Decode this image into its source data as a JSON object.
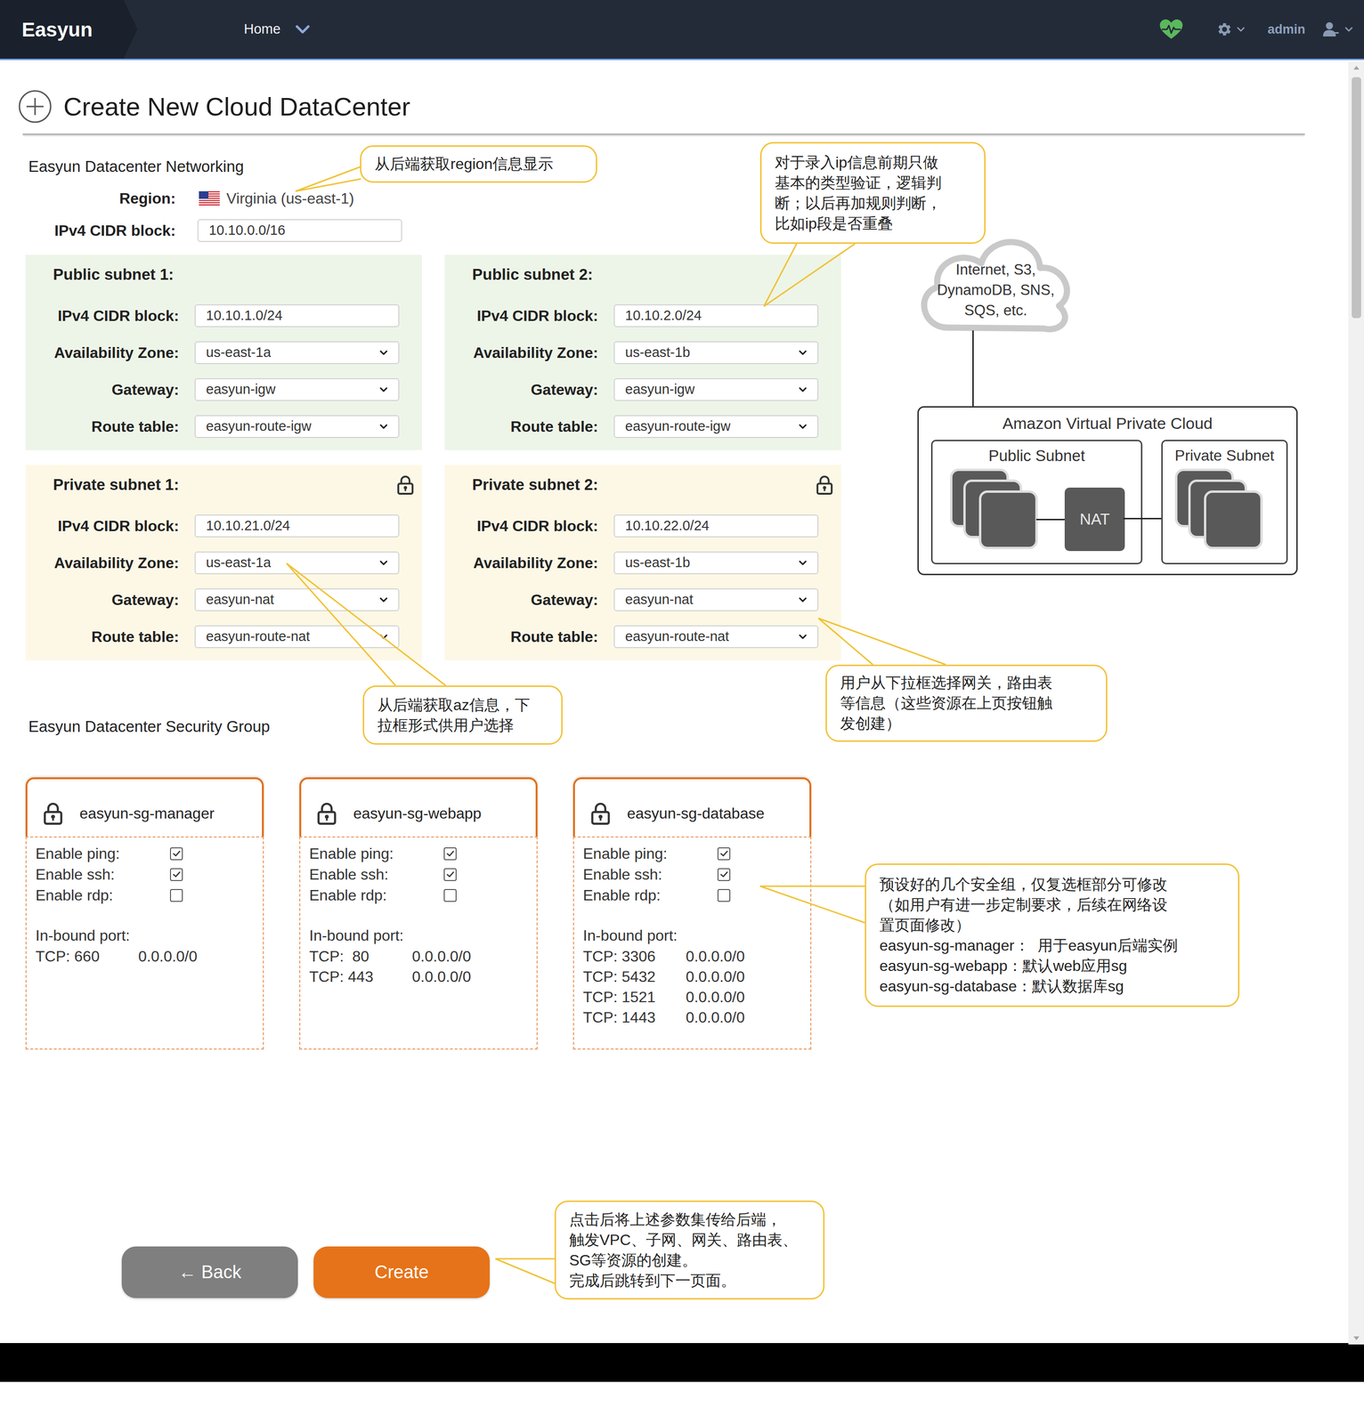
{
  "nav": {
    "logo": "Easyun",
    "menu": "Home",
    "user": "admin"
  },
  "page": {
    "title": "Create New Cloud DataCenter"
  },
  "networking": {
    "title": "Easyun Datacenter Networking",
    "region_label": "Region:",
    "region": "Virginia (us-east-1)",
    "cidr_label": "IPv4 CIDR block:",
    "cidr": "10.10.0.0/16",
    "subnets": [
      {
        "title": "Public subnet 1:",
        "kind": "public",
        "fields": [
          {
            "label": "IPv4 CIDR block:",
            "value": "10.10.1.0/24",
            "kind": "input"
          },
          {
            "label": "Availability Zone:",
            "value": "us-east-1a",
            "kind": "select"
          },
          {
            "label": "Gateway:",
            "value": "easyun-igw",
            "kind": "select"
          },
          {
            "label": "Route table:",
            "value": "easyun-route-igw",
            "kind": "select"
          }
        ]
      },
      {
        "title": "Public subnet 2:",
        "kind": "public",
        "fields": [
          {
            "label": "IPv4 CIDR block:",
            "value": "10.10.2.0/24",
            "kind": "input"
          },
          {
            "label": "Availability Zone:",
            "value": "us-east-1b",
            "kind": "select"
          },
          {
            "label": "Gateway:",
            "value": "easyun-igw",
            "kind": "select"
          },
          {
            "label": "Route table:",
            "value": "easyun-route-igw",
            "kind": "select"
          }
        ]
      },
      {
        "title": "Private subnet 1:",
        "kind": "private",
        "fields": [
          {
            "label": "IPv4 CIDR block:",
            "value": "10.10.21.0/24",
            "kind": "input"
          },
          {
            "label": "Availability Zone:",
            "value": "us-east-1a",
            "kind": "select"
          },
          {
            "label": "Gateway:",
            "value": "easyun-nat",
            "kind": "select"
          },
          {
            "label": "Route table:",
            "value": "easyun-route-nat",
            "kind": "select"
          }
        ]
      },
      {
        "title": "Private subnet 2:",
        "kind": "private",
        "fields": [
          {
            "label": "IPv4 CIDR block:",
            "value": "10.10.22.0/24",
            "kind": "input"
          },
          {
            "label": "Availability Zone:",
            "value": "us-east-1b",
            "kind": "select"
          },
          {
            "label": "Gateway:",
            "value": "easyun-nat",
            "kind": "select"
          },
          {
            "label": "Route table:",
            "value": "easyun-route-nat",
            "kind": "select"
          }
        ]
      }
    ]
  },
  "security": {
    "title": "Easyun Datacenter Security Group",
    "groups": [
      {
        "name": "easyun-sg-manager",
        "options": [
          {
            "label": "Enable ping:",
            "checked": true
          },
          {
            "label": "Enable ssh:",
            "checked": true
          },
          {
            "label": "Enable rdp:",
            "checked": false
          }
        ],
        "inbound_label": "In-bound port:",
        "ports": [
          {
            "port": "TCP: 660",
            "cidr": "0.0.0.0/0"
          }
        ]
      },
      {
        "name": "easyun-sg-webapp",
        "options": [
          {
            "label": "Enable ping:",
            "checked": true
          },
          {
            "label": "Enable ssh:",
            "checked": true
          },
          {
            "label": "Enable rdp:",
            "checked": false
          }
        ],
        "inbound_label": "In-bound port:",
        "ports": [
          {
            "port": "TCP:  80",
            "cidr": "0.0.0.0/0"
          },
          {
            "port": "TCP: 443",
            "cidr": "0.0.0.0/0"
          }
        ]
      },
      {
        "name": "easyun-sg-database",
        "options": [
          {
            "label": "Enable ping:",
            "checked": true
          },
          {
            "label": "Enable ssh:",
            "checked": true
          },
          {
            "label": "Enable rdp:",
            "checked": false
          }
        ],
        "inbound_label": "In-bound port:",
        "ports": [
          {
            "port": "TCP: 3306",
            "cidr": "0.0.0.0/0"
          },
          {
            "port": "TCP: 5432",
            "cidr": "0.0.0.0/0"
          },
          {
            "port": "TCP: 1521",
            "cidr": "0.0.0.0/0"
          },
          {
            "port": "TCP: 1443",
            "cidr": "0.0.0.0/0"
          }
        ]
      }
    ]
  },
  "buttons": [
    {
      "label": "← Back",
      "kind": "secondary"
    },
    {
      "label": "Create",
      "kind": "primary"
    }
  ],
  "diagram": {
    "cloud": [
      "Internet, S3,",
      "DynamoDB, SNS,",
      "SQS, etc."
    ],
    "vpc": "Amazon Virtual Private Cloud",
    "public_subnet": "Public Subnet",
    "private_subnet": "Private Subnet",
    "nat": "NAT"
  },
  "annotations": [
    {
      "lines": [
        "从后端获取region信息显示"
      ]
    },
    {
      "lines": [
        "对于录入ip信息前期只做",
        "基本的类型验证，逻辑判",
        "断；以后再加规则判断，",
        "比如ip段是否重叠"
      ]
    },
    {
      "lines": [
        "从后端获取az信息，下",
        "拉框形式供用户选择"
      ]
    },
    {
      "lines": [
        "用户从下拉框选择网关，路由表",
        "等信息（这些资源在上页按钮触",
        "发创建）"
      ]
    },
    {
      "lines": [
        "预设好的几个安全组，仅复选框部分可修改",
        "（如用户有进一步定制要求，后续在网络设",
        "置页面修改）",
        "easyun-sg-manager：  用于easyun后端实例",
        "easyun-sg-webapp：默认web应用sg",
        "easyun-sg-database：默认数据库sg"
      ]
    },
    {
      "lines": [
        "点击后将上述参数集传给后端，",
        "触发VPC、子网、网关、路由表、",
        "SG等资源的创建。",
        "完成后跳转到下一页面。"
      ]
    }
  ]
}
